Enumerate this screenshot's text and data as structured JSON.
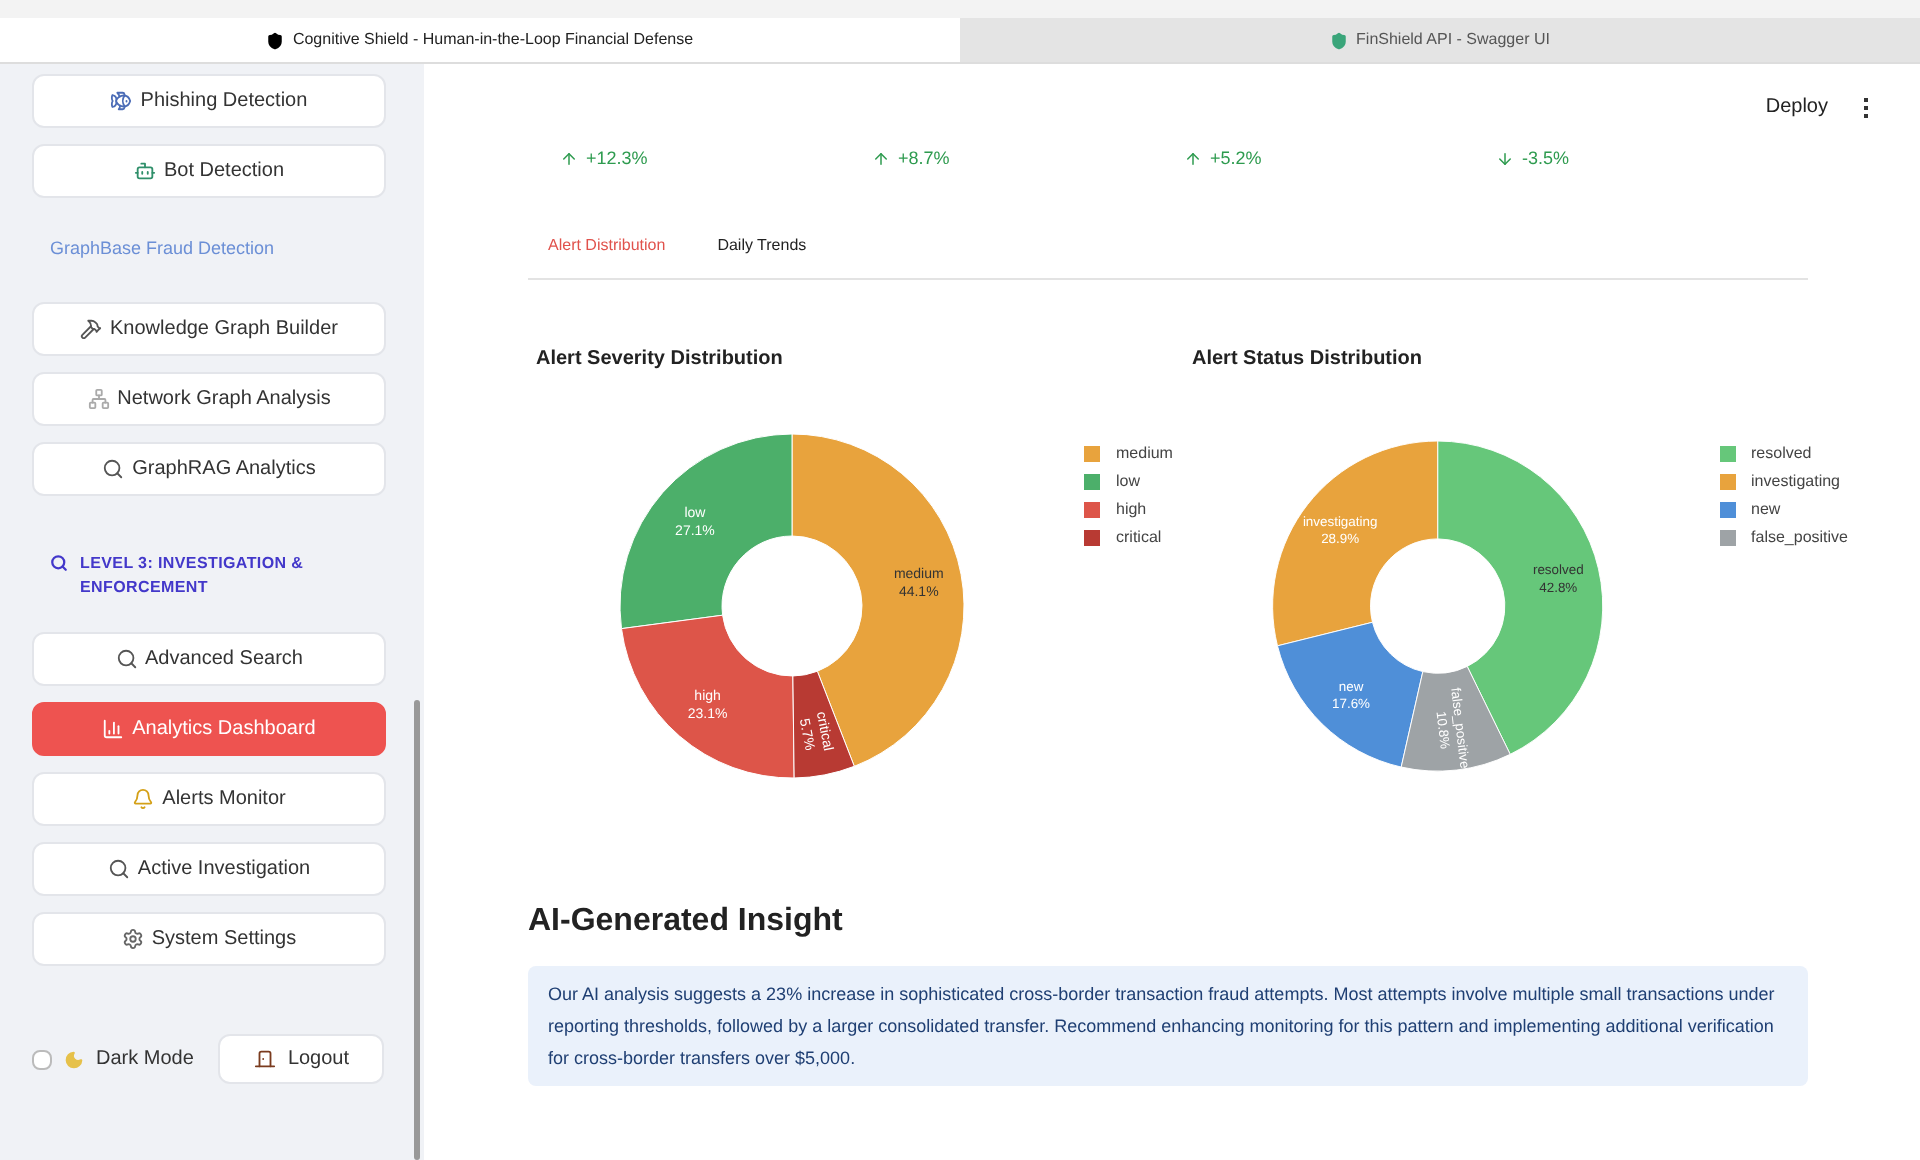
{
  "browser_tabs": [
    {
      "title": "Cognitive Shield - Human-in-the-Loop Financial Defense",
      "selected": true
    },
    {
      "title": "FinShield API - Swagger UI",
      "selected": false
    }
  ],
  "sidebar": {
    "items": [
      {
        "kind": "button",
        "label": "Phishing Detection",
        "selected": false
      },
      {
        "kind": "button",
        "label": "Bot Detection",
        "selected": false
      },
      {
        "kind": "section",
        "label": "GraphBase Fraud Detection"
      },
      {
        "kind": "button",
        "label": "Knowledge Graph Builder",
        "selected": false
      },
      {
        "kind": "button",
        "label": "Network Graph Analysis",
        "selected": false
      },
      {
        "kind": "button",
        "label": "GraphRAG Analytics",
        "selected": false
      },
      {
        "kind": "heading",
        "label": "LEVEL 3: INVESTIGATION & ENFORCEMENT"
      },
      {
        "kind": "button",
        "label": "Advanced Search",
        "selected": false
      },
      {
        "kind": "button",
        "label": "Analytics Dashboard",
        "selected": true
      },
      {
        "kind": "button",
        "label": "Alerts Monitor",
        "selected": false
      },
      {
        "kind": "button",
        "label": "Active Investigation",
        "selected": false
      },
      {
        "kind": "button",
        "label": "System Settings",
        "selected": false
      }
    ],
    "dark_mode": {
      "label": "Dark Mode",
      "checked": false
    },
    "logout": "Logout"
  },
  "header": {
    "deploy": "Deploy"
  },
  "metric_deltas": [
    {
      "text": "+12.3%",
      "kind": "up"
    },
    {
      "text": "+8.7%",
      "kind": "up"
    },
    {
      "text": "+5.2%",
      "kind": "up"
    },
    {
      "text": "-3.5%",
      "kind": "down"
    }
  ],
  "tabs": [
    {
      "label": "Alert Distribution",
      "selected": true
    },
    {
      "label": "Daily Trends",
      "selected": false
    }
  ],
  "charts": [
    {
      "chart_data": {
        "type": "donut",
        "title": "Alert Severity Distribution",
        "categories": [
          "medium",
          "low",
          "high",
          "critical"
        ],
        "values": [
          44.1,
          27.1,
          23.1,
          5.7
        ],
        "legend": "right",
        "colors": [
          "#e8a33d",
          "#4caf6a",
          "#dd5549",
          "#b83a33"
        ],
        "value_labels": [
          "44.1%",
          "27.1%",
          "23.1%",
          "5.7%"
        ]
      }
    },
    {
      "chart_data": {
        "type": "donut",
        "title": "Alert Status Distribution",
        "categories": [
          "resolved",
          "investigating",
          "new",
          "false_positive"
        ],
        "values": [
          42.8,
          28.9,
          17.6,
          10.8
        ],
        "legend": "right",
        "colors": [
          "#66c77a",
          "#e8a33d",
          "#4f8fd8",
          "#9ea3a6"
        ],
        "value_labels": [
          "42.8%",
          "28.9%",
          "17.6%",
          "10.8%"
        ]
      }
    }
  ],
  "insight": {
    "heading": "AI-Generated Insight",
    "text": "Our AI analysis suggests a 23% increase in sophisticated cross-border transaction fraud attempts. Most attempts involve multiple small transactions under reporting thresholds, followed by a larger consolidated transfer. Recommend enhancing monitoring for this pattern and implementing additional verification for cross-border transfers over $5,000."
  }
}
